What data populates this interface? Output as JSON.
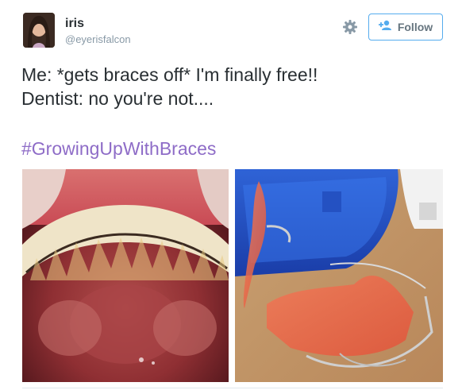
{
  "user": {
    "name": "iris",
    "handle": "@eyerisfalcon"
  },
  "actions": {
    "follow_label": "Follow",
    "settings_icon": "gear-icon",
    "follow_icon": "add-user-icon"
  },
  "tweet": {
    "line1": "Me: *gets braces off* I'm finally free!!",
    "line2": "Dentist: no you're not....",
    "hashtag": "#GrowingUpWithBraces"
  },
  "colors": {
    "text": "#292f33",
    "handle": "#8899a6",
    "hashtag": "#8e6cc7",
    "follow_border": "#55acee"
  },
  "media": [
    {
      "subject": "teeth-with-bonded-retainer-photo"
    },
    {
      "subject": "blue-case-and-retainer-photo"
    }
  ]
}
